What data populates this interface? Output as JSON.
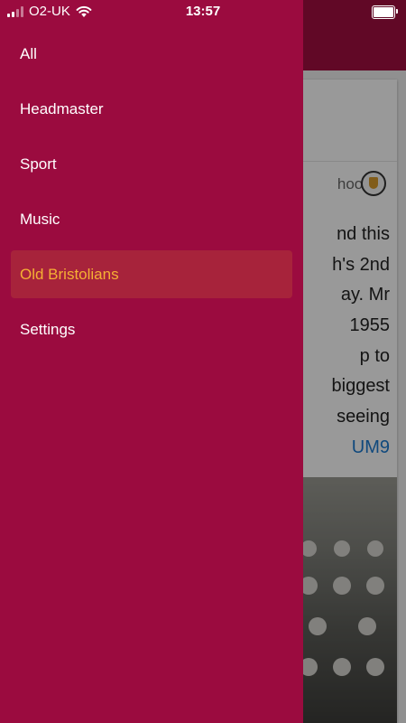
{
  "status_bar": {
    "carrier": "O2-UK",
    "time": "13:57"
  },
  "drawer": {
    "background_color": "#9b0b3f",
    "active_color": "#f5b034",
    "items": [
      {
        "label": "All",
        "active": false
      },
      {
        "label": "Headmaster",
        "active": false
      },
      {
        "label": "Sport",
        "active": false
      },
      {
        "label": "Music",
        "active": false
      },
      {
        "label": "Old Bristolians",
        "active": true
      },
      {
        "label": "Settings",
        "active": false
      }
    ]
  },
  "feed": {
    "header_color": "#a20e40",
    "card": {
      "source_fragment": "hool",
      "crest_icon": "school-crest-icon",
      "text_lines": [
        "nd this",
        "h's 2nd",
        "ay. Mr",
        "1955",
        "p to",
        "biggest",
        "seeing"
      ],
      "link_fragment": "UM9",
      "link_color": "#1c7bd1"
    }
  }
}
